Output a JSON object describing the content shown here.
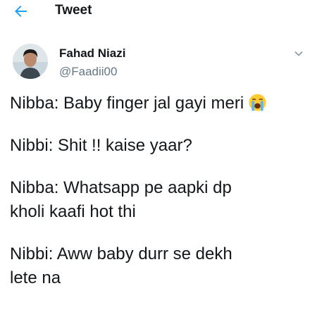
{
  "header": {
    "title": "Tweet",
    "back_icon": "arrow-left-icon",
    "accent": "#1da1f2"
  },
  "author": {
    "name": "Fahad Niazi",
    "handle": "@Faadii00",
    "avatar_icon": "avatar",
    "menu_icon": "chevron-down-icon"
  },
  "tweet": {
    "lines": [
      "Nibba: Baby finger jal gayi meri",
      "Nibbi: Shit !! kaise yaar?",
      "Nibba: Whatsapp pe aapki dp\nkholi kaafi hot thi",
      "Nibbi: Aww baby durr se dekh\nlete na"
    ],
    "emoji": "loudly-crying-face-icon"
  }
}
